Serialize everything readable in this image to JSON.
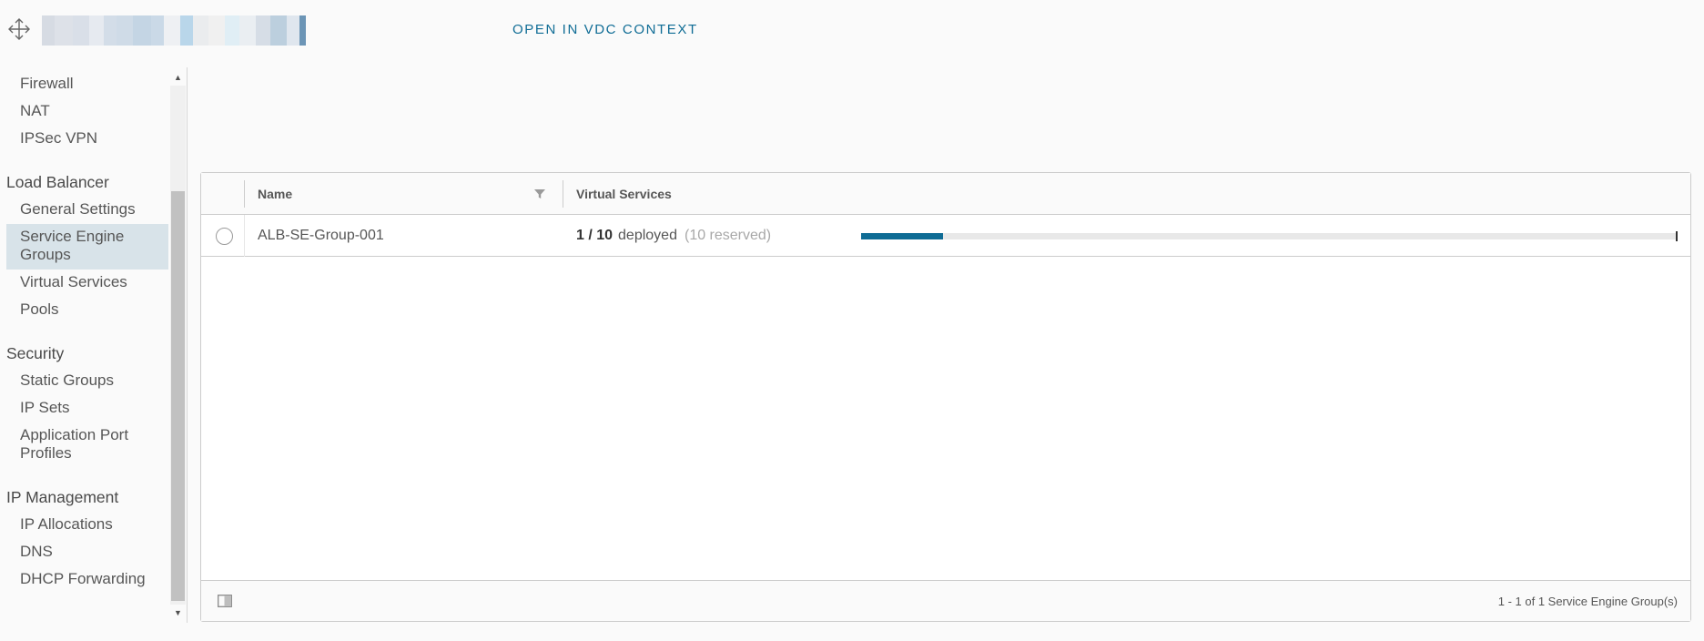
{
  "header": {
    "open_in_vdc_label": "OPEN IN VDC CONTEXT",
    "blurred_title_colors": [
      "#d6dbe3",
      "#dde1e8",
      "#d9dfe8",
      "#e6eaf0",
      "#d3dde8",
      "#cfdbe7",
      "#c4d5e4",
      "#cad9e7",
      "#eef0f3",
      "#b9d6ea",
      "#eaecee",
      "#f0f0f0",
      "#e0eef5",
      "#eaeef2",
      "#d6dde6",
      "#bccfde",
      "#dfe6ee",
      "#6c95b6"
    ]
  },
  "sidebar": {
    "items_top": [
      {
        "label": "Firewall"
      },
      {
        "label": "NAT"
      },
      {
        "label": "IPSec VPN"
      }
    ],
    "load_balancer": {
      "title": "Load Balancer",
      "items": [
        {
          "label": "General Settings"
        },
        {
          "label": "Service Engine Groups",
          "line1": "Service Engine",
          "line2": "Groups",
          "active": true
        },
        {
          "label": "Virtual Services"
        },
        {
          "label": "Pools"
        }
      ]
    },
    "security": {
      "title": "Security",
      "items": [
        {
          "label": "Static Groups"
        },
        {
          "label": "IP Sets"
        },
        {
          "label": "Application Port Profiles",
          "line1": "Application Port",
          "line2": "Profiles"
        }
      ]
    },
    "ip_management": {
      "title": "IP Management",
      "items": [
        {
          "label": "IP Allocations"
        },
        {
          "label": "DNS"
        },
        {
          "label": "DHCP Forwarding"
        }
      ]
    },
    "active_color": "#d8e3e9"
  },
  "grid": {
    "columns": [
      "Name",
      "Virtual Services"
    ],
    "rows": [
      {
        "name": "ALB-SE-Group-001",
        "vs_count": "1 / 10",
        "vs_deployed": "deployed",
        "vs_reserved": "(10 reserved)",
        "usage_fraction": 0.1
      }
    ],
    "footer": "1 - 1 of 1 Service Engine Group(s)",
    "accent": "#0f6c95"
  }
}
